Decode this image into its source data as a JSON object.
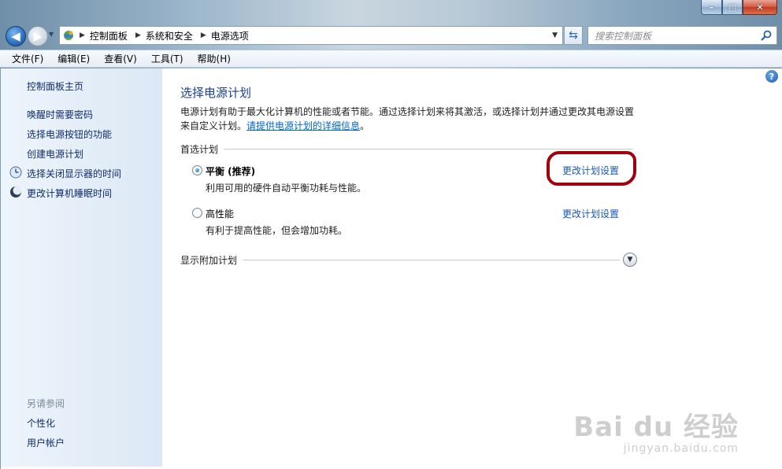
{
  "window": {
    "controls": {
      "minimize": "–",
      "maximize": "□",
      "close": "✕"
    }
  },
  "nav": {
    "back_icon": "arrow-left-icon",
    "forward_icon": "arrow-right-icon",
    "breadcrumbs": [
      "控制面板",
      "系统和安全",
      "电源选项"
    ],
    "search_placeholder": "搜索控制面板"
  },
  "menubar": {
    "items": [
      "文件(F)",
      "编辑(E)",
      "查看(V)",
      "工具(T)",
      "帮助(H)"
    ]
  },
  "sidebar": {
    "home": "控制面板主页",
    "links": [
      "唤醒时需要密码",
      "选择电源按钮的功能",
      "创建电源计划",
      "选择关闭显示器的时间",
      "更改计算机睡眠时间"
    ],
    "see_also_heading": "另请参阅",
    "see_also": [
      "个性化",
      "用户帐户"
    ]
  },
  "main": {
    "title": "选择电源计划",
    "description_line1": "电源计划有助于最大化计算机的性能或者节能。通过选择计划来将其激活，或选择计划并通过更改其电源设置",
    "description_line2_prefix": "来自定义计划。",
    "description_link": "请提供电源计划的详细信息",
    "description_suffix": "。",
    "preferred_section": "首选计划",
    "plans": [
      {
        "name": "平衡 (推荐)",
        "desc": "利用可用的硬件自动平衡功耗与性能。",
        "selected": true,
        "link": "更改计划设置"
      },
      {
        "name": "高性能",
        "desc": "有利于提高性能，但会增加功耗。",
        "selected": false,
        "link": "更改计划设置"
      }
    ],
    "extra_section": "显示附加计划",
    "help_label": "?"
  },
  "watermark": {
    "main": "Bai du 经验",
    "sub": "jingyan.baidu.com"
  },
  "colors": {
    "link": "#1a57b8",
    "title": "#1d3f8f",
    "highlight": "#a3000e",
    "sidebar_bg": "#dbe8f5"
  }
}
